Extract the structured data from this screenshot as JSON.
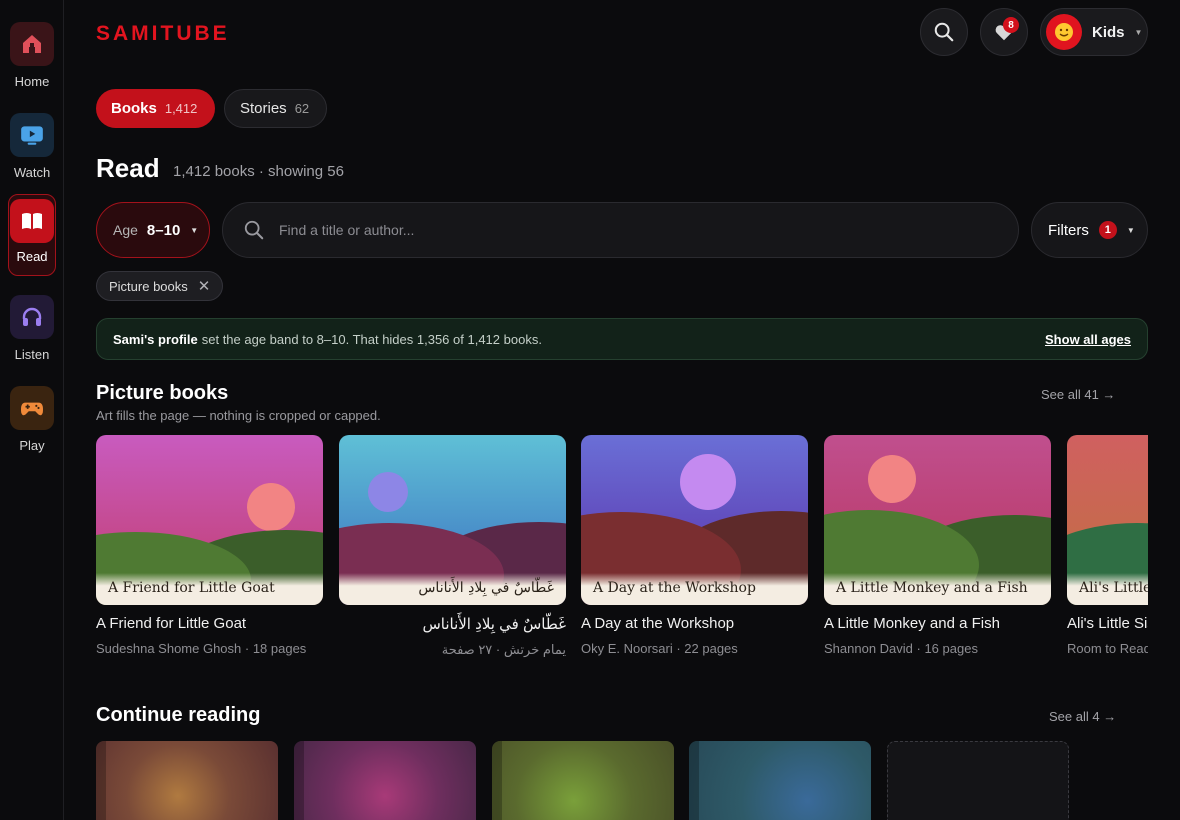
{
  "app": {
    "logo": "SAMITUBE"
  },
  "sidebar": {
    "items": [
      {
        "label": "Home",
        "icon": "home-icon",
        "color": "#e0505a",
        "bg": "#3a1418"
      },
      {
        "label": "Watch",
        "icon": "tv-icon",
        "color": "#4aa3e8",
        "bg": "#15283a"
      },
      {
        "label": "Read",
        "icon": "book-icon",
        "color": "#ffffff",
        "bg": "#c3111b",
        "active": true
      },
      {
        "label": "Listen",
        "icon": "headphones-icon",
        "color": "#9b7ef0",
        "bg": "#221a36"
      },
      {
        "label": "Play",
        "icon": "gamepad-icon",
        "color": "#f08a3a",
        "bg": "#3a2410"
      }
    ]
  },
  "header": {
    "favorites_count": "8",
    "profile_name": "Kids"
  },
  "tabs": [
    {
      "label": "Books",
      "count": "1,412",
      "active": true
    },
    {
      "label": "Stories",
      "count": "62"
    }
  ],
  "page": {
    "title": "Read",
    "subtitle": "1,412 books · showing 56"
  },
  "filters": {
    "age_label": "Age",
    "age_value": "8–10",
    "search_placeholder": "Find a title or author...",
    "filters_label": "Filters",
    "filters_count": "1",
    "active_chip": "Picture books"
  },
  "notice": {
    "profile": "Sami's profile",
    "text": "set the age band to 8–10. That hides 1,356 of 1,412 books.",
    "action": "Show all ages"
  },
  "picture_books": {
    "title": "Picture books",
    "subtitle": "Art fills the page — nothing is cropped or capped.",
    "see_all": "See all 41 →",
    "books": [
      {
        "title": "A Friend for Little Goat",
        "meta": "Sudeshna Shome Ghosh · 18 pages"
      },
      {
        "title": "غَطّاسٌ في بِلادِ الأَناناس",
        "meta": "يمام خرتش · ٢٧ صفحة",
        "rtl": true
      },
      {
        "title": "A Day at the Workshop",
        "meta": "Oky E. Noorsari · 22 pages"
      },
      {
        "title": "A Little Monkey and a Fish",
        "meta": "Shannon David · 16 pages"
      },
      {
        "title": "Ali's Little Sister",
        "meta": "Room to Read"
      }
    ]
  },
  "continue_reading": {
    "title": "Continue reading",
    "see_all": "See all 4 →"
  }
}
